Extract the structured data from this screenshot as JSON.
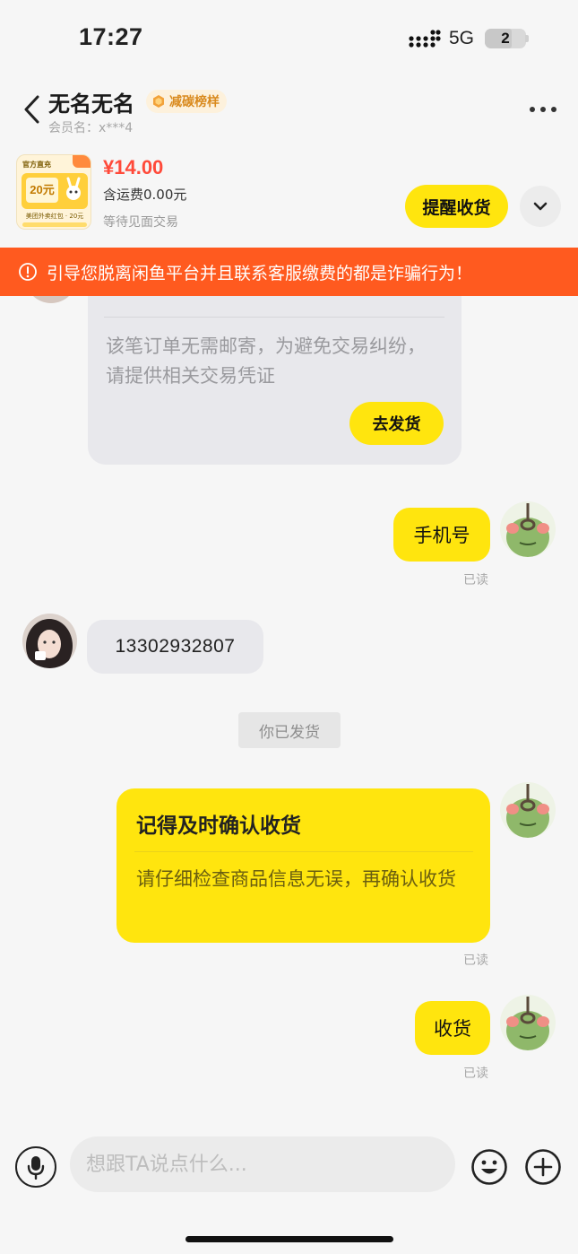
{
  "status_bar": {
    "time": "17:27",
    "network": "5G",
    "battery": "2"
  },
  "header": {
    "name": "无名无名",
    "badge": "减碳榜样",
    "member_label": "会员名：x***4"
  },
  "product": {
    "thumb_top_label": "官方直充",
    "thumb_amount": "20元",
    "thumb_bottom_label": "美团外卖红包 · 20元",
    "price": "¥14.00",
    "shipping": "含运费0.00元",
    "status": "等待见面交易",
    "remind_button": "提醒收货"
  },
  "warning": {
    "text": "引导您脱离闲鱼平台并且联系客服缴费的都是诈骗行为！"
  },
  "messages": {
    "card_gray_text": "该笔订单无需邮寄，为避免交易纠纷，请提供相关交易凭证",
    "ship_button": "去发货",
    "m1_text": "手机号",
    "m1_read": "已读",
    "m2_text": "13302932807",
    "system_note": "你已发货",
    "card_title": "记得及时确认收货",
    "card_text": "请仔细检查商品信息无误，再确认收货",
    "card_read": "已读",
    "m3_text": "收货",
    "m3_read": "已读"
  },
  "input_bar": {
    "placeholder": "想跟TA说点什么..."
  },
  "colors": {
    "accent_yellow": "#ffe50e",
    "warning_orange": "#ff5a1f",
    "price_red": "#ff4a3a"
  }
}
